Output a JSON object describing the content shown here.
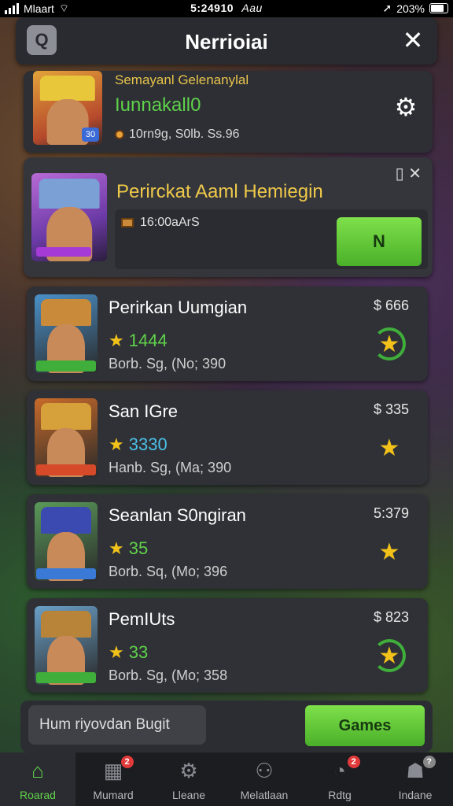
{
  "status_bar": {
    "carrier": "Mlaart",
    "time": "5:24910",
    "time_suffix": "Aau",
    "battery": "203%"
  },
  "header": {
    "title": "Nerrioiai",
    "left_icon": "search-icon",
    "close_icon": "close-icon"
  },
  "featured": {
    "subtitle": "Semayanl Gelenanylal",
    "name": "Iunnakall0",
    "stats": "10rn9g, S0lb. Ss.96",
    "badge": "30"
  },
  "panel": {
    "title": "Perirckat Aaml Hemiegin",
    "stat": "16:00aArS",
    "button_label": "N"
  },
  "rows": [
    {
      "name": "Perirkan Uumgian",
      "price": "$ 666",
      "score": "1444",
      "score_color": "#5fd24a",
      "meta": "Borb. Sg, (No; 390",
      "badge_ring": true,
      "hat_color": "#c98a3a",
      "bg": "#4a90c8",
      "tag_color": "#3fae3a"
    },
    {
      "name": "San IGre",
      "price": "$ 335",
      "score": "3330",
      "score_color": "#4ac0e8",
      "meta": "Hanb. Sg, (Ma; 390",
      "badge_ring": false,
      "hat_color": "#d6a03a",
      "bg": "#c86a2a",
      "tag_color": "#d64a2a"
    },
    {
      "name": "Seanlan S0ngiran",
      "price": "5:379",
      "score": "35",
      "score_color": "#5fd24a",
      "meta": "Borb. Sq, (Mo; 396",
      "badge_ring": false,
      "hat_color": "#3a4ab0",
      "bg": "#5a9a5a",
      "tag_color": "#3a7ad6"
    },
    {
      "name": "PemIUts",
      "price": "$ 823",
      "score": "33",
      "score_color": "#5fd24a",
      "meta": "Borb. Sg, (Mo; 358",
      "badge_ring": true,
      "hat_color": "#b8843a",
      "bg": "#6aa0c8",
      "tag_color": "#3fae3a"
    }
  ],
  "bottom": {
    "search_placeholder": "Hum riyovdan Bugit",
    "games_button": "Games"
  },
  "nav": [
    {
      "label": "Roarad",
      "icon": "home-icon",
      "badge": ""
    },
    {
      "label": "Mumard",
      "icon": "grid-icon",
      "badge": "2"
    },
    {
      "label": "Lleane",
      "icon": "gear-icon",
      "badge": ""
    },
    {
      "label": "Melatlaan",
      "icon": "people-icon",
      "badge": ""
    },
    {
      "label": "Rdtg",
      "icon": "clock-icon",
      "badge": "2"
    },
    {
      "label": "Indane",
      "icon": "profile-icon",
      "badge": "?"
    }
  ]
}
